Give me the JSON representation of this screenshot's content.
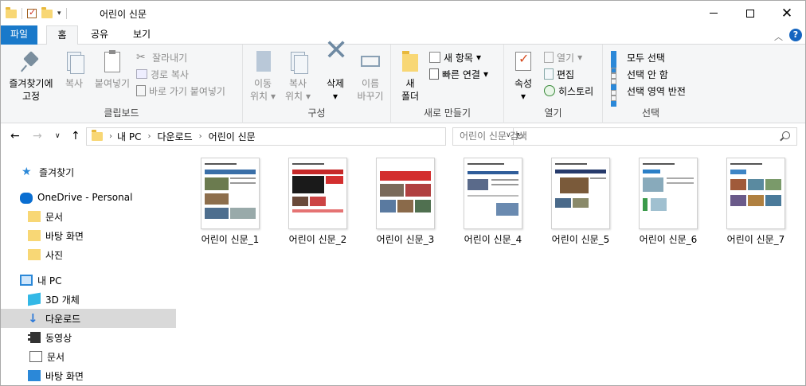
{
  "window": {
    "title": "어린이 신문",
    "close_glyph": "✕"
  },
  "ribbon_tabs": {
    "file": "파일",
    "home": "홈",
    "share": "공유",
    "view": "보기",
    "collapse_glyph": "︿",
    "help_glyph": "?"
  },
  "clipboard": {
    "pin_line1": "즐겨찾기에",
    "pin_line2": "고정",
    "copy": "복사",
    "paste": "붙여넣기",
    "cut": "잘라내기",
    "copy_path": "경로 복사",
    "paste_shortcut": "바로 가기 붙여넣기",
    "label": "클립보드"
  },
  "organize": {
    "move_line1": "이동",
    "move_line2": "위치",
    "copyto_line1": "복사",
    "copyto_line2": "위치",
    "delete": "삭제",
    "rename_line1": "이름",
    "rename_line2": "바꾸기",
    "label": "구성",
    "dropdown_glyph": "▾"
  },
  "new": {
    "folder_line1": "새",
    "folder_line2": "폴더",
    "new_item": "새 항목",
    "easy_access": "빠른 연결",
    "label": "새로 만들기"
  },
  "open": {
    "properties": "속성",
    "open": "열기",
    "edit": "편집",
    "history": "히스토리",
    "label": "열기"
  },
  "select": {
    "select_all": "모두 선택",
    "select_none": "선택 안 함",
    "invert": "선택 영역 반전",
    "label": "선택"
  },
  "address": {
    "back": "←",
    "forward": "→",
    "recent": "∨",
    "up": "↑",
    "segments": [
      "내 PC",
      "다운로드",
      "어린이 신문"
    ],
    "chevron": "›",
    "refresh": "↻",
    "search_placeholder": "어린이 신문 검색"
  },
  "navpane": {
    "quick_access": "즐겨찾기",
    "onedrive": "OneDrive - Personal",
    "onedrive_children": [
      "문서",
      "바탕 화면",
      "사진"
    ],
    "this_pc": "내 PC",
    "pc_children": [
      "3D 개체",
      "다운로드",
      "동영상",
      "문서",
      "바탕 화면"
    ],
    "selected": "다운로드"
  },
  "files": [
    {
      "name": "어린이 신문_1",
      "accent": "#3a6fa8"
    },
    {
      "name": "어린이 신문_2",
      "accent": "#1a1a1a"
    },
    {
      "name": "어린이 신문_3",
      "accent": "#d32f2f"
    },
    {
      "name": "어린이 신문_4",
      "accent": "#2f5d9a"
    },
    {
      "name": "어린이 신문_5",
      "accent": "#263a6b"
    },
    {
      "name": "어린이 신문_6",
      "accent": "#2a7fc7"
    },
    {
      "name": "어린이 신문_7",
      "accent": "#3d85c6"
    }
  ]
}
